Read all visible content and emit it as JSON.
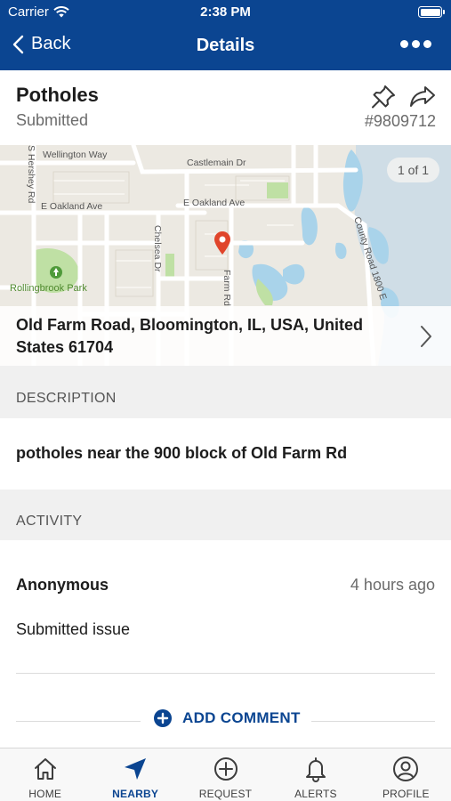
{
  "status_bar": {
    "carrier": "Carrier",
    "time": "2:38 PM"
  },
  "nav": {
    "back_label": "Back",
    "title": "Details"
  },
  "issue": {
    "title": "Potholes",
    "status": "Submitted",
    "id": "#9809712"
  },
  "map": {
    "count_label": "1 of 1",
    "street_labels": {
      "wellington": "Wellington Way",
      "castlemain": "Castlemain Dr",
      "e_oakland_w": "E Oakland Ave",
      "e_oakland_e": "E Oakland Ave",
      "hershey": "S Hershey Rd",
      "county_road": "County Road 1800 E",
      "chelsea": "Chelsea Dr",
      "farm": "Farm Rd",
      "park": "Rollingbrook Park"
    },
    "address": "Old Farm Road, Bloomington, IL, USA, United States  61704"
  },
  "description": {
    "header": "DESCRIPTION",
    "text": "potholes near the 900 block of Old Farm Rd"
  },
  "activity": {
    "header": "ACTIVITY",
    "entries": [
      {
        "author": "Anonymous",
        "time": "4 hours ago",
        "text": "Submitted issue"
      }
    ],
    "add_comment_label": "ADD COMMENT"
  },
  "tabs": [
    {
      "label": "HOME",
      "icon": "home-icon"
    },
    {
      "label": "NEARBY",
      "icon": "nearby-icon"
    },
    {
      "label": "REQUEST",
      "icon": "request-icon"
    },
    {
      "label": "ALERTS",
      "icon": "alerts-icon"
    },
    {
      "label": "PROFILE",
      "icon": "profile-icon"
    }
  ],
  "colors": {
    "brand": "#0b4591",
    "pin": "#e0452b",
    "water": "#a9d3ea",
    "park": "#bfe0a4"
  }
}
